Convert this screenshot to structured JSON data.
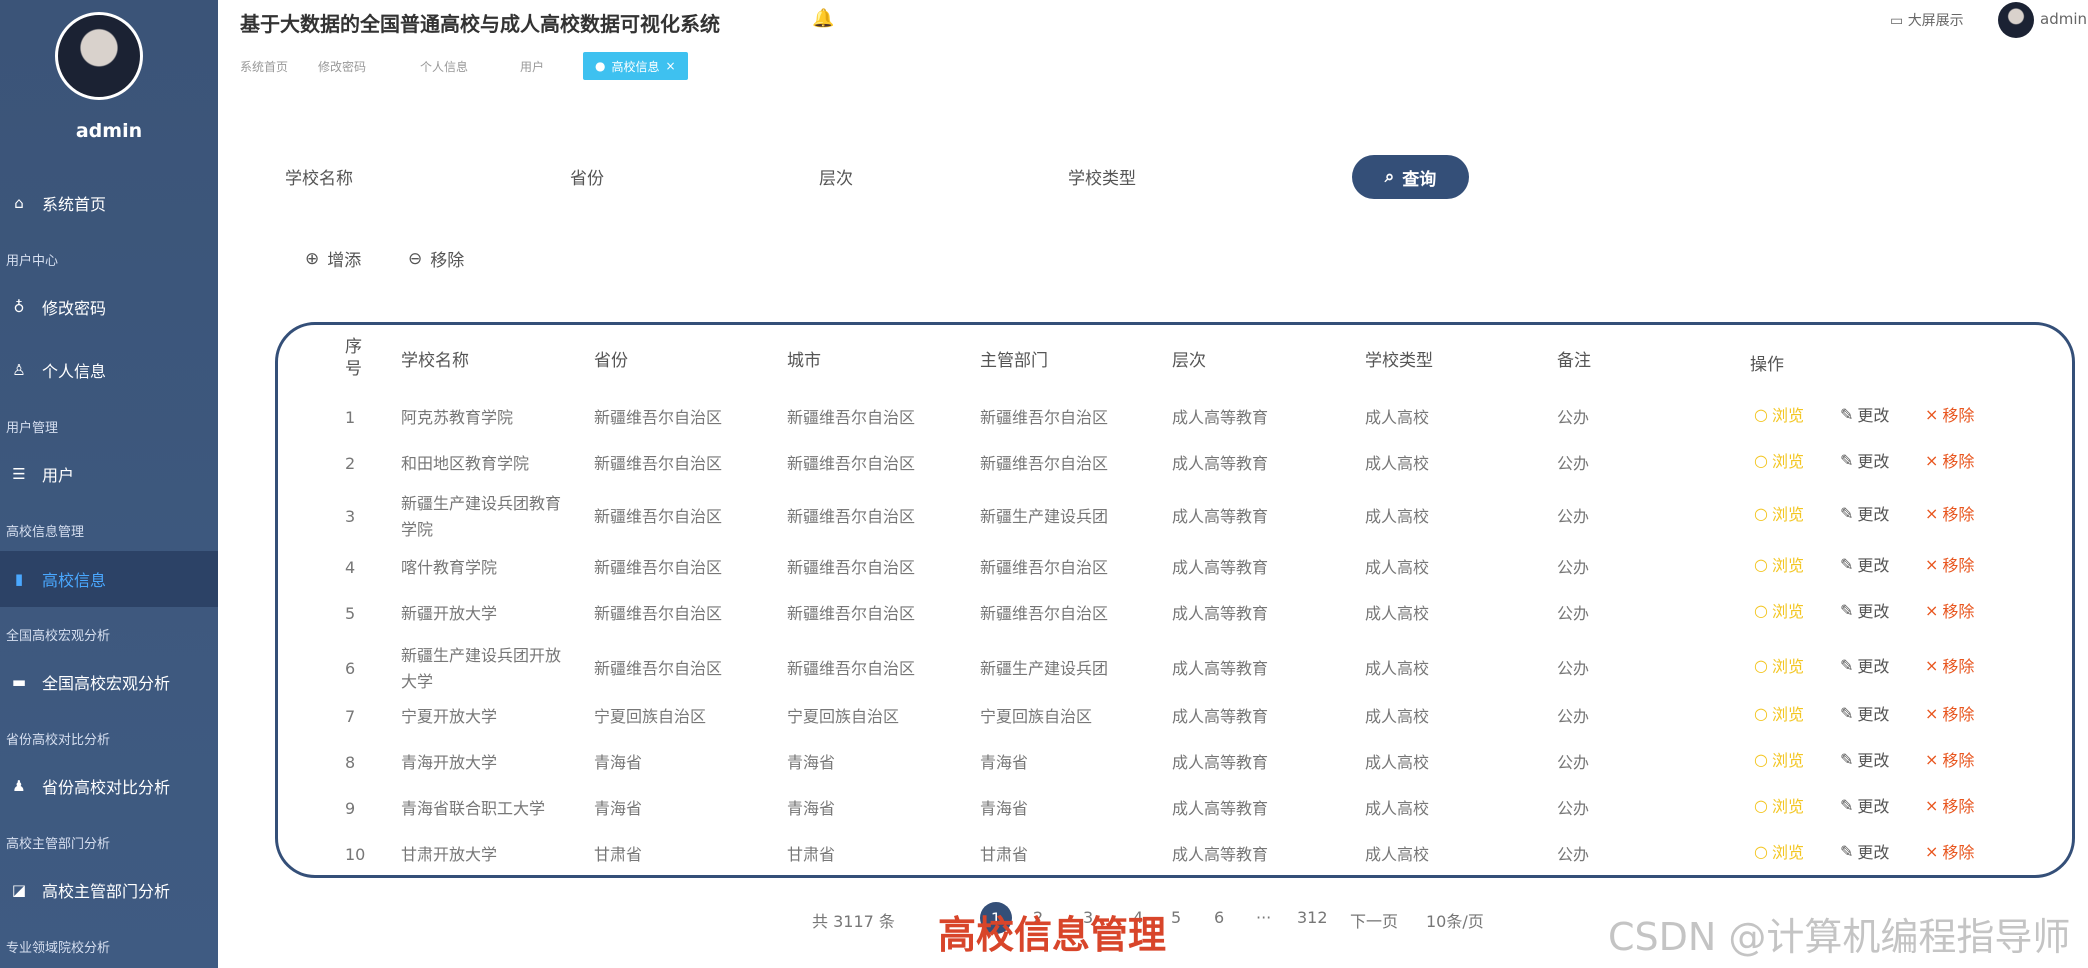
{
  "app": {
    "title": "基于大数据的全国普通高校与成人高校数据可视化系统",
    "big_screen": "大屏展示",
    "user": "admin"
  },
  "sidebar": {
    "user": "admin",
    "home": "系统首页",
    "group_user_center": "用户中心",
    "change_password": "修改密码",
    "profile": "个人信息",
    "group_user_mgmt": "用户管理",
    "users": "用户",
    "group_school_mgmt": "高校信息管理",
    "school_info": "高校信息",
    "group_macro": "全国高校宏观分析",
    "macro": "全国高校宏观分析",
    "group_province": "省份高校对比分析",
    "province": "省份高校对比分析",
    "group_dept": "高校主管部门分析",
    "dept": "高校主管部门分析",
    "group_major": "专业领域院校分析"
  },
  "tabs": [
    "系统首页",
    "修改密码",
    "个人信息",
    "用户"
  ],
  "active_tab": "高校信息",
  "search": {
    "name_label": "学校名称",
    "province_label": "省份",
    "level_label": "层次",
    "type_label": "学校类型",
    "query": "查询"
  },
  "actions": {
    "add": "增添",
    "remove": "移除"
  },
  "table": {
    "headers": [
      "序号",
      "学校名称",
      "省份",
      "城市",
      "主管部门",
      "层次",
      "学校类型",
      "备注",
      "操作"
    ],
    "op_labels": {
      "view": "浏览",
      "edit": "更改",
      "delete": "移除"
    },
    "rows": [
      [
        "1",
        "阿克苏教育学院",
        "新疆维吾尔自治区",
        "新疆维吾尔自治区",
        "新疆维吾尔自治区",
        "成人高等教育",
        "成人高校",
        "公办"
      ],
      [
        "2",
        "和田地区教育学院",
        "新疆维吾尔自治区",
        "新疆维吾尔自治区",
        "新疆维吾尔自治区",
        "成人高等教育",
        "成人高校",
        "公办"
      ],
      [
        "3",
        "新疆生产建设兵团教育学院",
        "新疆维吾尔自治区",
        "新疆维吾尔自治区",
        "新疆生产建设兵团",
        "成人高等教育",
        "成人高校",
        "公办"
      ],
      [
        "4",
        "喀什教育学院",
        "新疆维吾尔自治区",
        "新疆维吾尔自治区",
        "新疆维吾尔自治区",
        "成人高等教育",
        "成人高校",
        "公办"
      ],
      [
        "5",
        "新疆开放大学",
        "新疆维吾尔自治区",
        "新疆维吾尔自治区",
        "新疆维吾尔自治区",
        "成人高等教育",
        "成人高校",
        "公办"
      ],
      [
        "6",
        "新疆生产建设兵团开放大学",
        "新疆维吾尔自治区",
        "新疆维吾尔自治区",
        "新疆生产建设兵团",
        "成人高等教育",
        "成人高校",
        "公办"
      ],
      [
        "7",
        "宁夏开放大学",
        "宁夏回族自治区",
        "宁夏回族自治区",
        "宁夏回族自治区",
        "成人高等教育",
        "成人高校",
        "公办"
      ],
      [
        "8",
        "青海开放大学",
        "青海省",
        "青海省",
        "青海省",
        "成人高等教育",
        "成人高校",
        "公办"
      ],
      [
        "9",
        "青海省联合职工大学",
        "青海省",
        "青海省",
        "青海省",
        "成人高等教育",
        "成人高校",
        "公办"
      ],
      [
        "10",
        "甘肃开放大学",
        "甘肃省",
        "甘肃省",
        "甘肃省",
        "成人高等教育",
        "成人高校",
        "公办"
      ]
    ]
  },
  "pagination": {
    "total": "共 3117 条",
    "current": "1",
    "pages": [
      "2",
      "3",
      "4",
      "5",
      "6"
    ],
    "ellipsis": "···",
    "last": "312",
    "next": "下一页",
    "size": "10条/页"
  },
  "overlay": {
    "title": "高校信息管理",
    "watermark": "CSDN @计算机编程指导师"
  }
}
